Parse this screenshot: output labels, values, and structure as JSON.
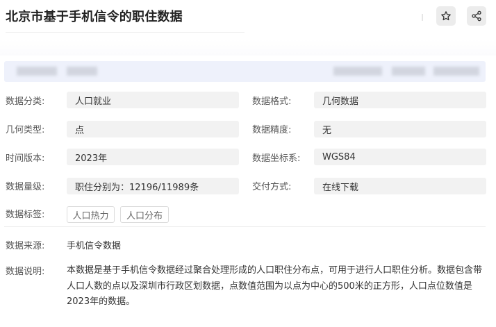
{
  "page": {
    "title": "北京市基于手机信令的职住数据"
  },
  "toolbar": {
    "star_icon": "star-icon",
    "share_icon": "share-icon"
  },
  "fields": {
    "category_label": "数据分类:",
    "category_value": "人口就业",
    "format_label": "数据格式:",
    "format_value": "几何数据",
    "geometry_label": "几何类型:",
    "geometry_value": "点",
    "precision_label": "数据精度:",
    "precision_value": "无",
    "version_label": "时间版本:",
    "version_value": "2023年",
    "crs_label": "数据坐标系:",
    "crs_value": "WGS84",
    "volume_label": "数据量级:",
    "volume_value": "职住分别为：12196/11989条",
    "delivery_label": "交付方式:",
    "delivery_value": "在线下载",
    "tags_label": "数据标签:",
    "tags": [
      "人口热力",
      "人口分布"
    ],
    "source_label": "数据来源:",
    "source_value": "手机信令数据",
    "description_label": "数据说明:",
    "description_value": "本数据是基于手机信令数据经过聚合处理形成的人口职住分布点，可用于进行人口职住分析。数据包含带人口人数的点以及深圳市行政区划数据，点数值范围为以点为中心的500米的正方形，人口点位数值是2023年的数据。"
  }
}
